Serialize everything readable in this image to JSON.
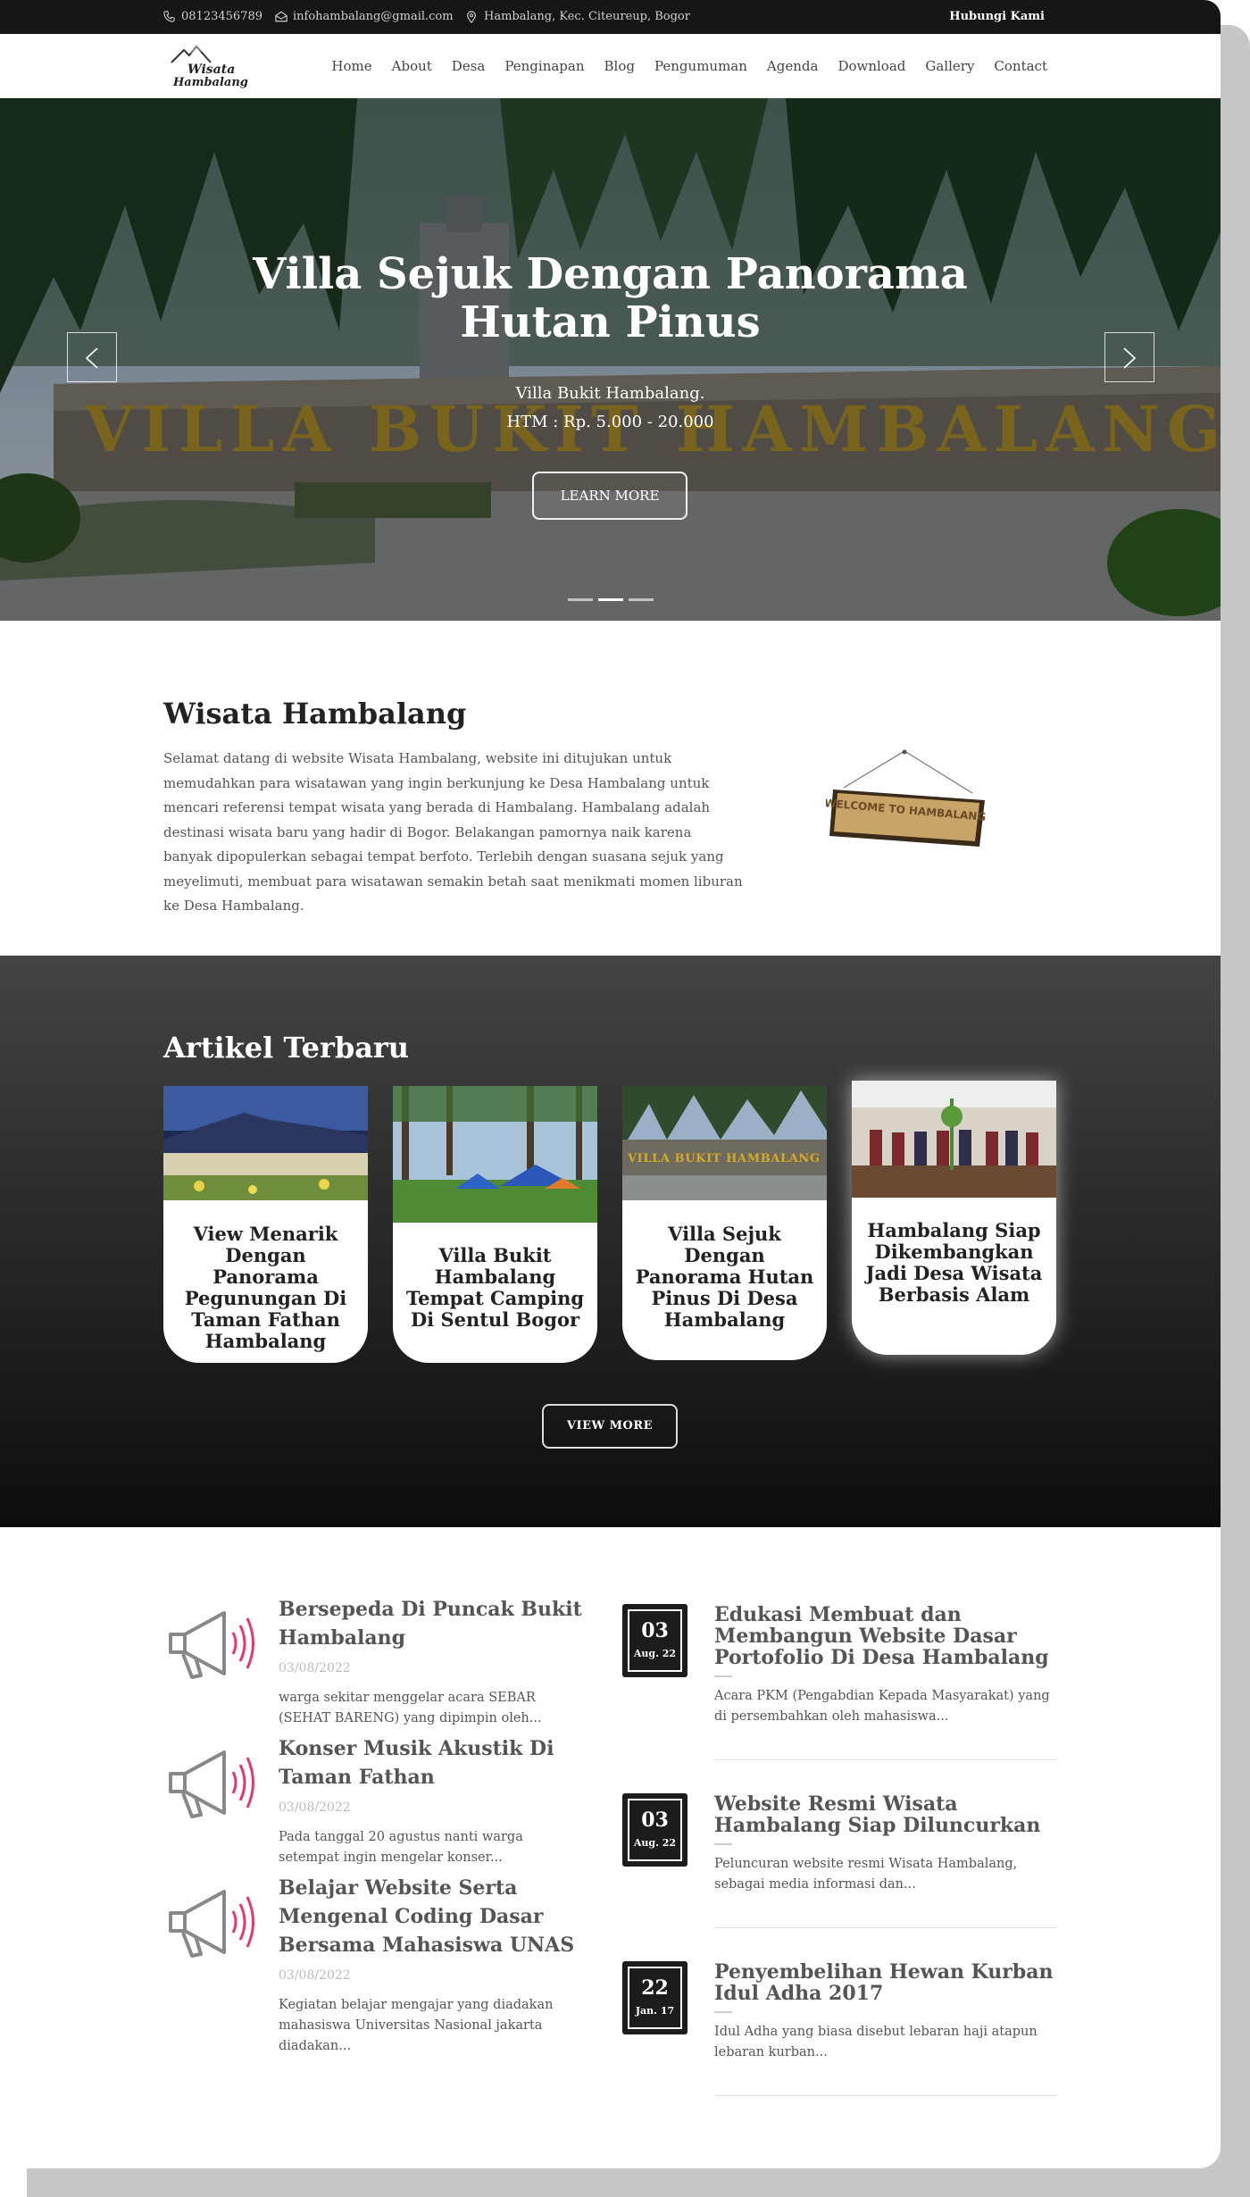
{
  "topbar": {
    "phone": "08123456789",
    "email": "infohambalang@gmail.com",
    "address": "Hambalang, Kec. Citeureup, Bogor",
    "contact_label": "Hubungi Kami"
  },
  "brand": {
    "logo_line1": "Wisata",
    "logo_line2": "Hambalang"
  },
  "nav": [
    "Home",
    "About",
    "Desa",
    "Penginapan",
    "Blog",
    "Pengumuman",
    "Agenda",
    "Download",
    "Gallery",
    "Contact"
  ],
  "hero": {
    "title": "Villa Sejuk Dengan Panorama Hutan Pinus",
    "subtitle": "Villa Bukit Hambalang.",
    "price": "HTM : Rp. 5.000 - 20.000",
    "button": "LEARN MORE",
    "sign_text": "VILLA BUKIT HAMBALANG",
    "slide_count": 3,
    "active_slide": 2
  },
  "about": {
    "title": "Wisata Hambalang",
    "text": "Selamat datang di website Wisata Hambalang, website ini ditujukan untuk memudahkan para wisatawan yang ingin berkunjung ke Desa Hambalang untuk mencari referensi tempat wisata yang berada di Hambalang. Hambalang adalah destinasi wisata baru yang hadir di Bogor. Belakangan pamornya naik karena banyak dipopulerkan sebagai tempat berfoto. Terlebih dengan suasana sejuk yang meyelimuti, membuat para wisatawan semakin betah saat menikmati momen liburan ke Desa Hambalang.",
    "sign_text": "WELCOME TO HAMBALANG"
  },
  "articles": {
    "title": "Artikel Terbaru",
    "items": [
      {
        "title": "View Menarik Dengan Panorama Pegunungan Di Taman Fathan Hambalang"
      },
      {
        "title": "Villa Bukit Hambalang Tempat Camping Di Sentul Bogor"
      },
      {
        "title": "Villa Sejuk Dengan Panorama Hutan Pinus Di Desa Hambalang"
      },
      {
        "title": "Hambalang Siap Dikembangkan Jadi Desa Wisata Berbasis Alam"
      }
    ],
    "card3_sign": "VILLA BUKIT HAMBALANG",
    "button": "VIEW MORE"
  },
  "announcements": [
    {
      "title": "Bersepeda Di Puncak Bukit Hambalang",
      "date": "03/08/2022",
      "desc": "warga sekitar menggelar acara SEBAR (SEHAT BARENG) yang dipimpin oleh..."
    },
    {
      "title": "Konser Musik Akustik Di Taman Fathan",
      "date": "03/08/2022",
      "desc": "Pada tanggal 20 agustus nanti warga setempat ingin mengelar konser..."
    },
    {
      "title": "Belajar Website Serta Mengenal Coding Dasar Bersama Mahasiswa UNAS",
      "date": "03/08/2022",
      "desc": "Kegiatan belajar mengajar yang diadakan mahasiswa Universitas Nasional jakarta diadakan..."
    }
  ],
  "agenda": [
    {
      "day": "03",
      "month": "Aug. 22",
      "title": "Edukasi Membuat dan Membangun Website Dasar Portofolio Di Desa Hambalang",
      "desc": "Acara PKM (Pengabdian Kepada Masyarakat) yang di persembahkan oleh mahasiswa..."
    },
    {
      "day": "03",
      "month": "Aug. 22",
      "title": "Website Resmi Wisata Hambalang Siap Diluncurkan",
      "desc": "Peluncuran website resmi Wisata Hambalang, sebagai media informasi dan..."
    },
    {
      "day": "22",
      "month": "Jan. 17",
      "title": "Penyembelihan Hewan Kurban Idul Adha 2017",
      "desc": "Idul Adha yang biasa disebut lebaran haji atapun lebaran kurban..."
    }
  ]
}
